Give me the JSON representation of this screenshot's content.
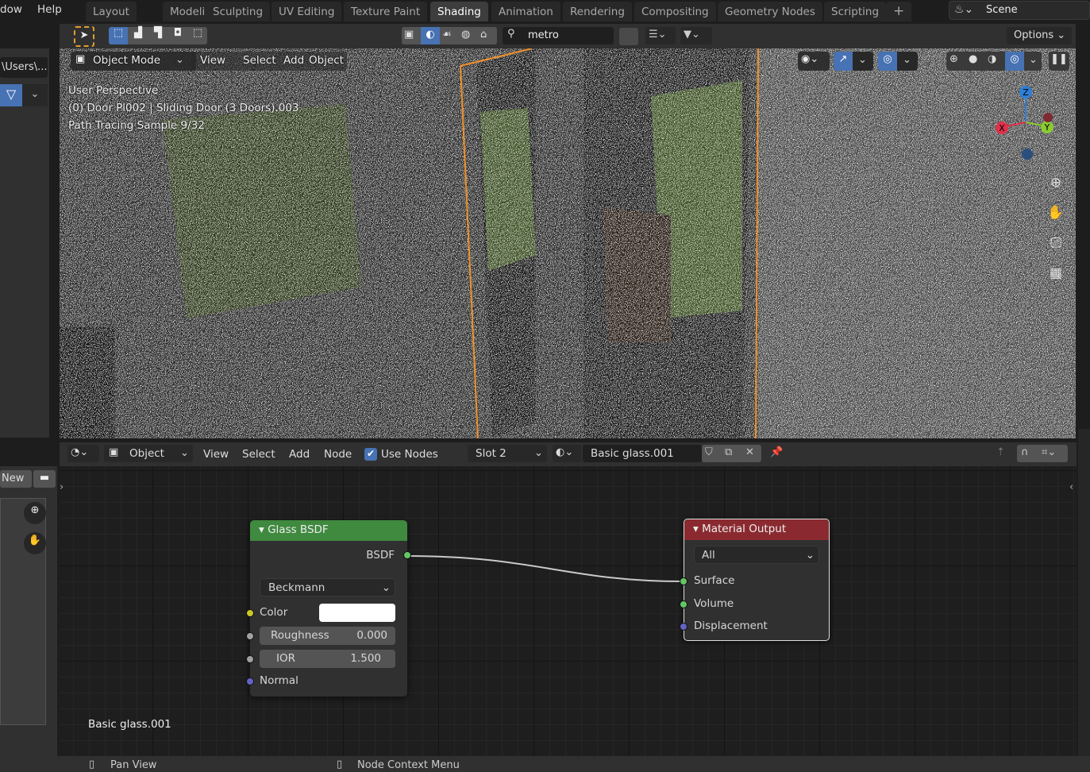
{
  "menubar": {
    "items": [
      "dow",
      "Help"
    ]
  },
  "workspaces": {
    "tabs": [
      "Layout",
      "Modeling",
      "Sculpting",
      "UV Editing",
      "Texture Paint",
      "Shading",
      "Animation",
      "Rendering",
      "Compositing",
      "Geometry Nodes",
      "Scripting"
    ],
    "active": "Shading",
    "add": "+"
  },
  "scene": {
    "label": "Scene"
  },
  "file_browser": {
    "path": "\\Users\\...",
    "new_label": "New"
  },
  "viewport_toolbar": {
    "search_value": "metro",
    "options_label": "Options"
  },
  "viewport_header": {
    "mode": "Object Mode",
    "menus": [
      "View",
      "Select",
      "Add",
      "Object"
    ]
  },
  "viewport_overlay": {
    "line1": "User Perspective",
    "line2": "(0) Door Pl002 | Sliding Door (3 Doors).003",
    "line3": "Path Tracing Sample 9/32"
  },
  "gizmo": {
    "x": "X",
    "y": "Y",
    "z": "Z"
  },
  "node_header": {
    "object_type": "Object",
    "menus": [
      "View",
      "Select",
      "Add",
      "Node"
    ],
    "use_nodes_label": "Use Nodes",
    "use_nodes_checked": true,
    "slot": "Slot 2",
    "material": "Basic glass.001"
  },
  "glass_node": {
    "title": "Glass BSDF",
    "output": "BSDF",
    "distribution": "Beckmann",
    "color_label": "Color",
    "color_value": "#ffffff",
    "roughness_label": "Roughness",
    "roughness": "0.000",
    "ior_label": "IOR",
    "ior": "1.500",
    "normal_label": "Normal",
    "header_color": "#3f8a3f"
  },
  "output_node": {
    "title": "Material Output",
    "target": "All",
    "inputs": [
      "Surface",
      "Volume",
      "Displacement"
    ],
    "header_color": "#8a2a30"
  },
  "node_editor": {
    "material_label": "Basic glass.001"
  },
  "statusbar": {
    "left": "Pan View",
    "middle": "Node Context Menu"
  },
  "colors": {
    "accent": "#4772b3",
    "selection_outline": "#f0902a",
    "socket_shader": "#63c763",
    "socket_color": "#c7c729",
    "socket_float": "#a1a1a1",
    "socket_vector": "#6363c7"
  }
}
